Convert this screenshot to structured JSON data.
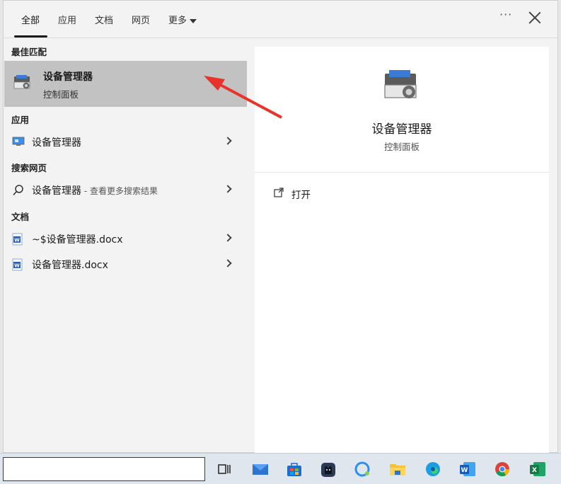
{
  "tabs": [
    {
      "label": "全部"
    },
    {
      "label": "应用"
    },
    {
      "label": "文档"
    },
    {
      "label": "网页"
    },
    {
      "label": "更多"
    }
  ],
  "sections": {
    "best_match": "最佳匹配",
    "apps": "应用",
    "web": "搜索网页",
    "docs": "文档"
  },
  "best_match": {
    "title": "设备管理器",
    "subtitle": "控制面板"
  },
  "app_results": [
    {
      "label": "设备管理器"
    }
  ],
  "web_results": [
    {
      "label": "设备管理器",
      "suffix": " - 查看更多搜索结果"
    }
  ],
  "doc_results": [
    {
      "label": "~$设备管理器.docx"
    },
    {
      "label": "设备管理器.docx"
    }
  ],
  "detail": {
    "title": "设备管理器",
    "subtitle": "控制面板",
    "actions": [
      {
        "label": "打开"
      }
    ]
  },
  "taskbar": {
    "search_value": "",
    "icons": [
      "task-view-icon",
      "mail-icon",
      "store-icon",
      "cat-app-icon",
      "chat-app-icon",
      "file-explorer-icon",
      "edge-icon",
      "word-icon",
      "chrome-icon",
      "excel-icon"
    ]
  },
  "colors": {
    "selected": "#c2c2c2",
    "arrow": "#e8332a",
    "panel": "#f3f3f3"
  }
}
